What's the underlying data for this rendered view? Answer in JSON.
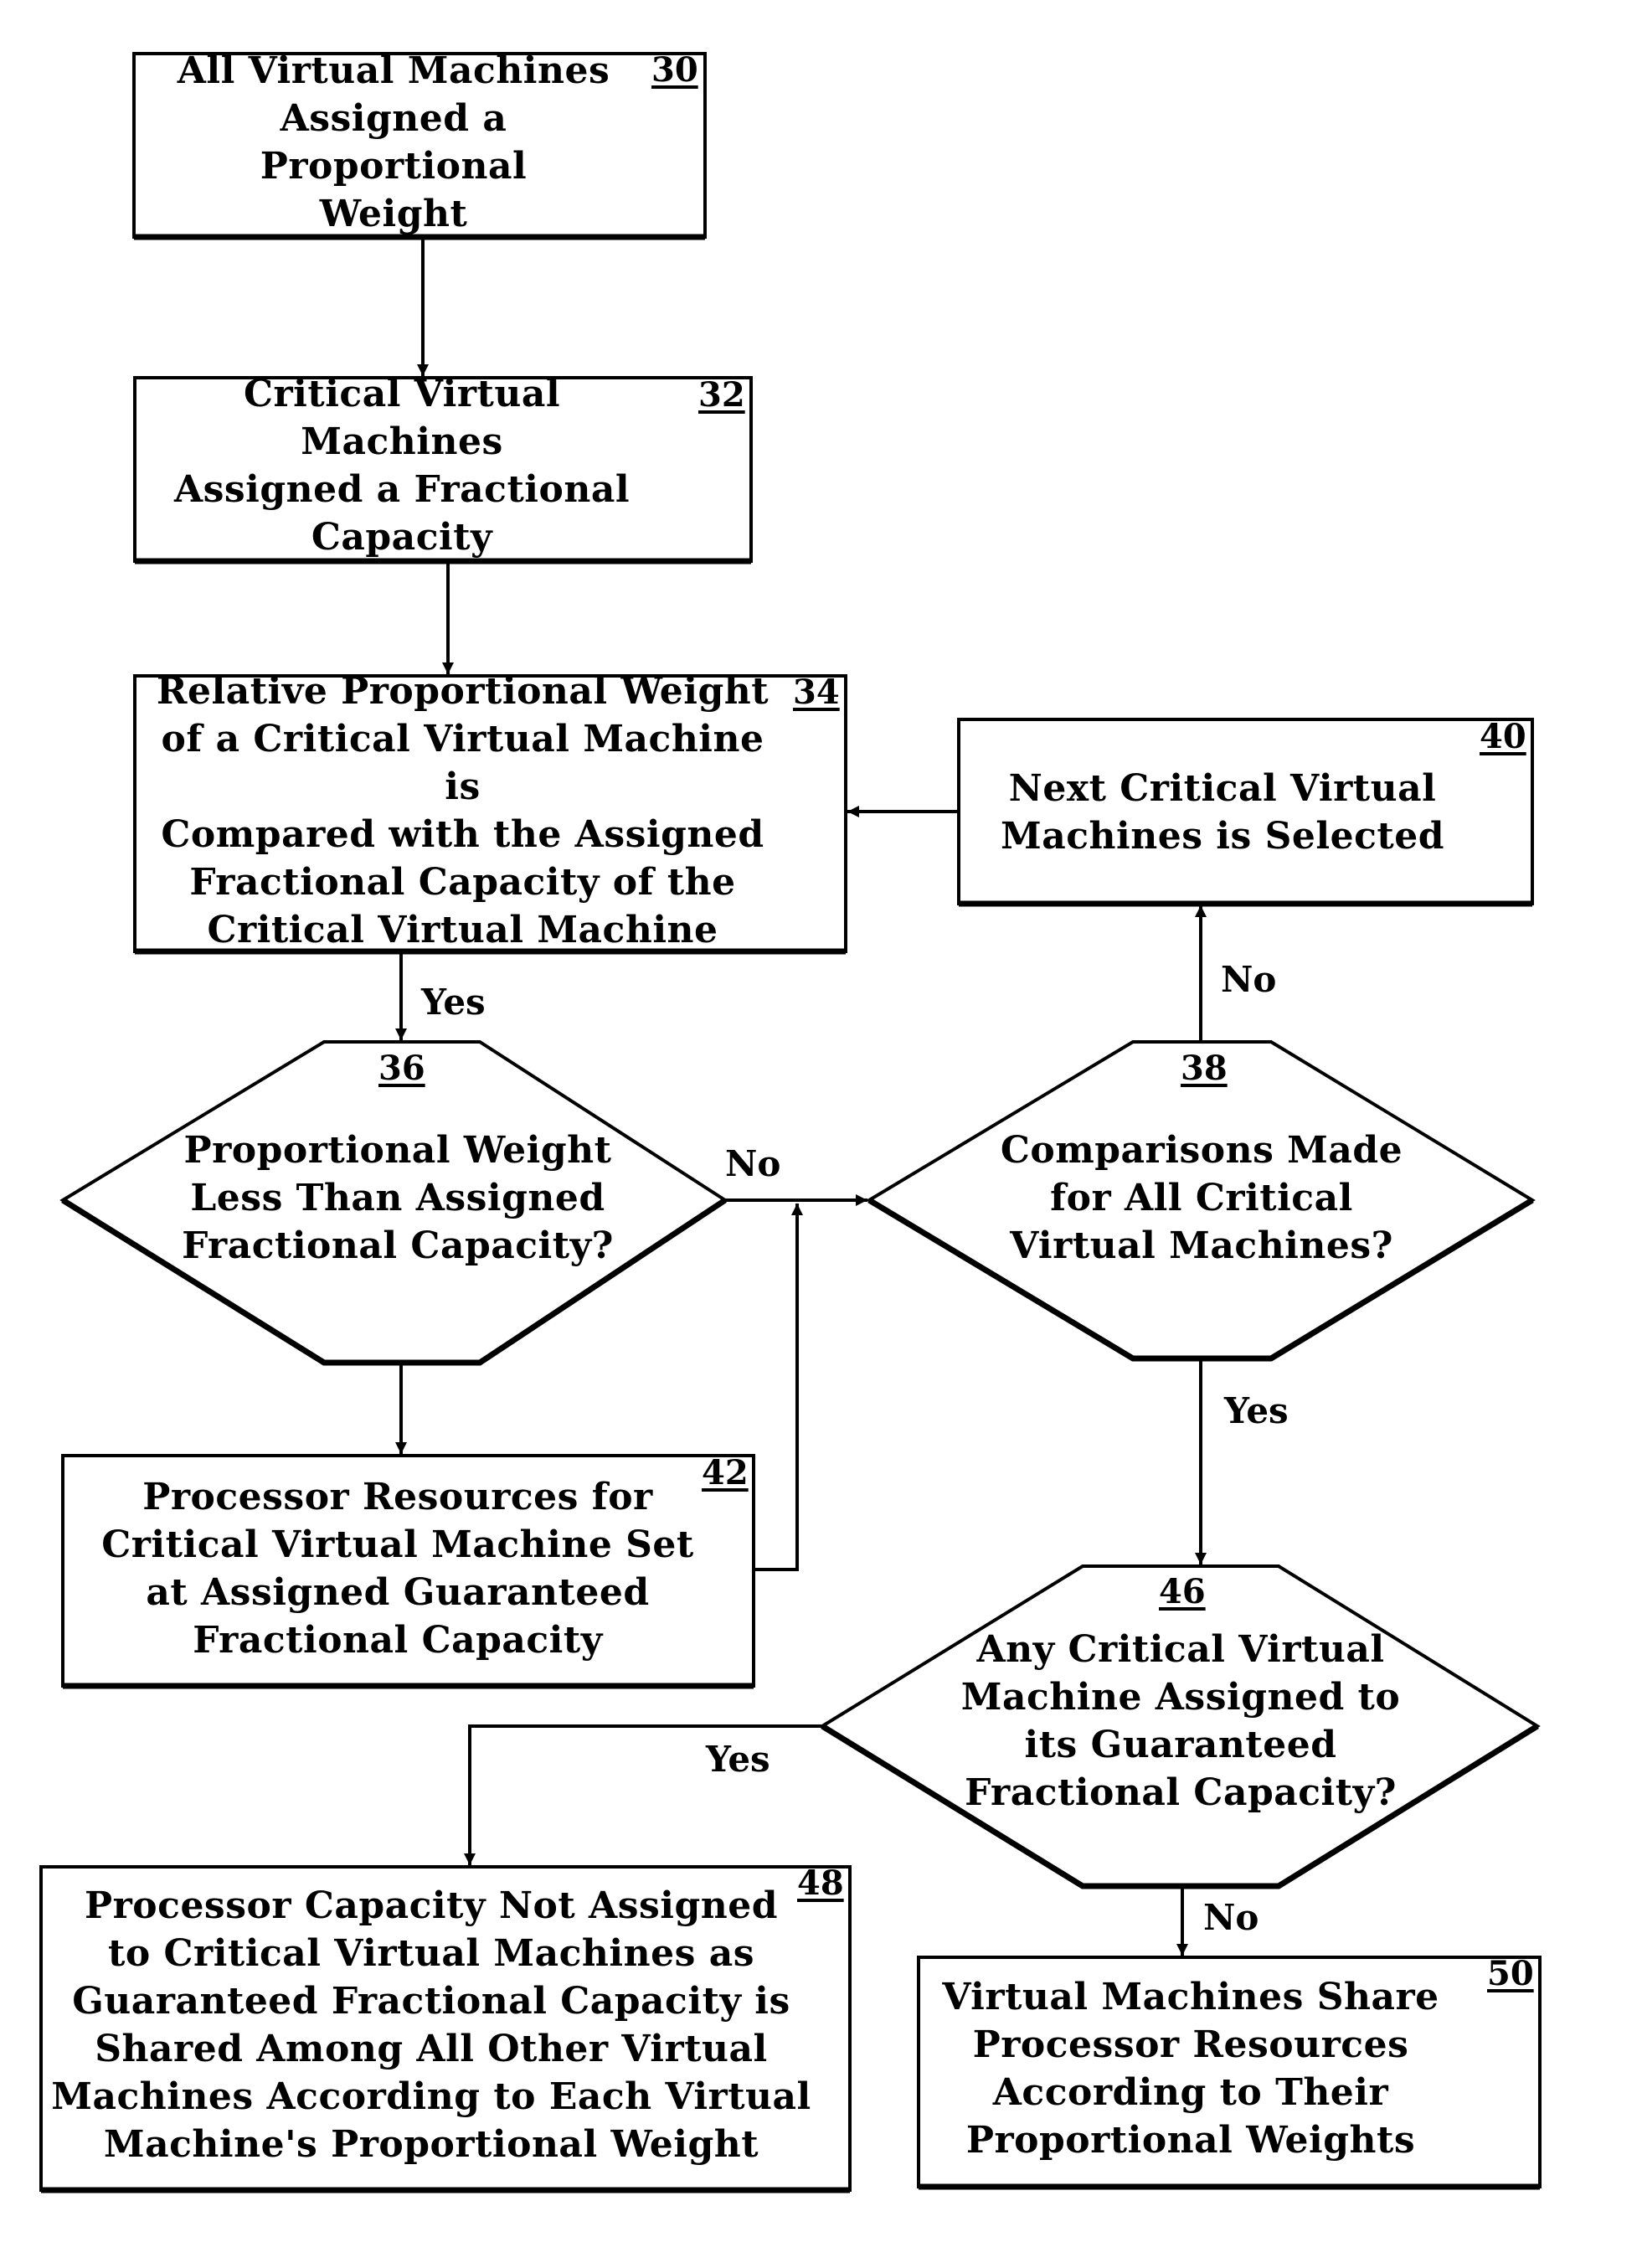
{
  "diagram": {
    "type": "flowchart",
    "nodes": [
      {
        "id": "30",
        "shape": "process",
        "ref": "30",
        "lines": [
          "All Virtual Machines",
          "Assigned a Proportional",
          "Weight"
        ]
      },
      {
        "id": "32",
        "shape": "process",
        "ref": "32",
        "lines": [
          "Critical Virtual Machines",
          "Assigned a Fractional",
          "Capacity"
        ]
      },
      {
        "id": "34",
        "shape": "process",
        "ref": "34",
        "lines": [
          "Relative Proportional Weight",
          "of a Critical Virtual Machine is",
          "Compared with the Assigned",
          "Fractional Capacity of the",
          "Critical Virtual Machine"
        ]
      },
      {
        "id": "36",
        "shape": "decision",
        "ref": "36",
        "lines": [
          "Proportional Weight",
          "Less Than Assigned",
          "Fractional Capacity?"
        ]
      },
      {
        "id": "38",
        "shape": "decision",
        "ref": "38",
        "lines": [
          "Comparisons Made",
          "for All Critical",
          "Virtual Machines?"
        ]
      },
      {
        "id": "40",
        "shape": "process",
        "ref": "40",
        "lines": [
          "Next Critical Virtual",
          "Machines is Selected"
        ]
      },
      {
        "id": "42",
        "shape": "process",
        "ref": "42",
        "lines": [
          "Processor Resources for",
          "Critical Virtual Machine Set",
          "at Assigned Guaranteed",
          "Fractional Capacity"
        ]
      },
      {
        "id": "46",
        "shape": "decision",
        "ref": "46",
        "lines": [
          "Any Critical Virtual",
          "Machine Assigned to",
          "its Guaranteed",
          "Fractional Capacity?"
        ]
      },
      {
        "id": "48",
        "shape": "process",
        "ref": "48",
        "lines": [
          "Processor Capacity Not Assigned",
          "to Critical Virtual Machines as",
          "Guaranteed Fractional Capacity is",
          "Shared Among All Other Virtual",
          "Machines According to Each Virtual",
          "Machine's Proportional Weight"
        ]
      },
      {
        "id": "50",
        "shape": "process",
        "ref": "50",
        "lines": [
          "Virtual Machines Share",
          "Processor Resources",
          "According to Their",
          "Proportional Weights"
        ]
      }
    ],
    "edges": [
      {
        "from": "30",
        "to": "32",
        "label": ""
      },
      {
        "from": "32",
        "to": "34",
        "label": ""
      },
      {
        "from": "34",
        "to": "36",
        "label": "Yes"
      },
      {
        "from": "36",
        "to": "38",
        "label": "No"
      },
      {
        "from": "36",
        "to": "42",
        "label": ""
      },
      {
        "from": "42",
        "to": "38",
        "label": ""
      },
      {
        "from": "38",
        "to": "40",
        "label": "No"
      },
      {
        "from": "40",
        "to": "34",
        "label": ""
      },
      {
        "from": "38",
        "to": "46",
        "label": "Yes"
      },
      {
        "from": "46",
        "to": "48",
        "label": "Yes"
      },
      {
        "from": "46",
        "to": "50",
        "label": "No"
      }
    ]
  },
  "colors": {
    "stroke": "#000000",
    "background": "#ffffff",
    "text": "#000000"
  }
}
